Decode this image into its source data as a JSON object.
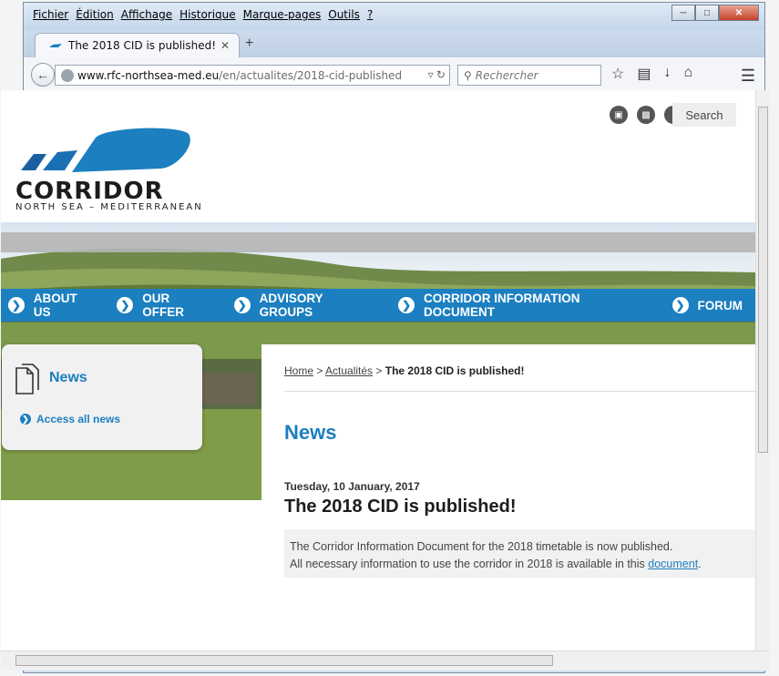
{
  "browser": {
    "menu": [
      "Fichier",
      "Édition",
      "Affichage",
      "Historique",
      "Marque-pages",
      "Outils",
      "?"
    ],
    "tab_title": "The 2018 CID is published! ...",
    "url_domain": "www.rfc-northsea-med.eu",
    "url_path": "/en/actualites/2018-cid-published",
    "search_placeholder": "Rechercher"
  },
  "site": {
    "search_label": "Search",
    "logo_title": "CORRIDOR",
    "logo_subtitle": "NORTH SEA – MEDITERRANEAN",
    "nav": [
      "ABOUT US",
      "OUR OFFER",
      "ADVISORY GROUPS",
      "CORRIDOR INFORMATION DOCUMENT",
      "FORUM"
    ],
    "sidebar": {
      "title": "News",
      "link": "Access all news"
    },
    "breadcrumb": {
      "home": "Home",
      "sep1": " > ",
      "section": "Actualités",
      "sep2": " > ",
      "current": "The 2018 CID is published!"
    },
    "page_title": "News",
    "post": {
      "date": "Tuesday, 10 January, 2017",
      "title": "The 2018 CID is published!",
      "line1": "The Corridor Information Document for the 2018 timetable is now published.",
      "line2_prefix": "All necessary information to use the corridor in 2018 is available in this ",
      "line2_link": "document",
      "line2_suffix": "."
    }
  },
  "colors": {
    "brand_blue": "#1b7fc0",
    "nav_text": "#ffffff"
  }
}
